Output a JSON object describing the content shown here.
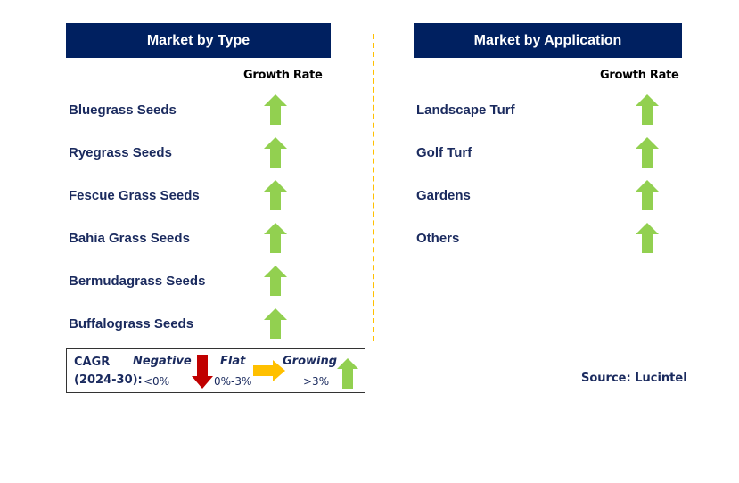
{
  "left_panel": {
    "title": "Market by Type",
    "growth_rate_label": "Growth Rate",
    "items": [
      {
        "label": "Bluegrass Seeds",
        "trend": "growing"
      },
      {
        "label": "Ryegrass Seeds",
        "trend": "growing"
      },
      {
        "label": "Fescue Grass Seeds",
        "trend": "growing"
      },
      {
        "label": "Bahia Grass Seeds",
        "trend": "growing"
      },
      {
        "label": "Bermudagrass Seeds",
        "trend": "growing"
      },
      {
        "label": "Buffalograss Seeds",
        "trend": "growing"
      }
    ]
  },
  "right_panel": {
    "title": "Market by Application",
    "growth_rate_label": "Growth Rate",
    "items": [
      {
        "label": "Landscape Turf",
        "trend": "growing"
      },
      {
        "label": "Golf Turf",
        "trend": "growing"
      },
      {
        "label": "Gardens",
        "trend": "growing"
      },
      {
        "label": "Others",
        "trend": "growing"
      }
    ]
  },
  "legend": {
    "cagr_label": "CAGR",
    "period_label": "(2024-30):",
    "negative": {
      "label": "Negative",
      "range": "<0%",
      "icon": "arrow-down-icon",
      "color": "#c00000"
    },
    "flat": {
      "label": "Flat",
      "range": "0%-3%",
      "icon": "arrow-right-icon",
      "color": "#ffc000"
    },
    "growing": {
      "label": "Growing",
      "range": ">3%",
      "icon": "arrow-up-icon",
      "color": "#92d050"
    }
  },
  "source": "Source: Lucintel",
  "colors": {
    "header_bg": "#002060",
    "up_arrow": "#92d050",
    "down_arrow": "#c00000",
    "flat_arrow": "#ffc000",
    "divider": "#ffc000"
  }
}
